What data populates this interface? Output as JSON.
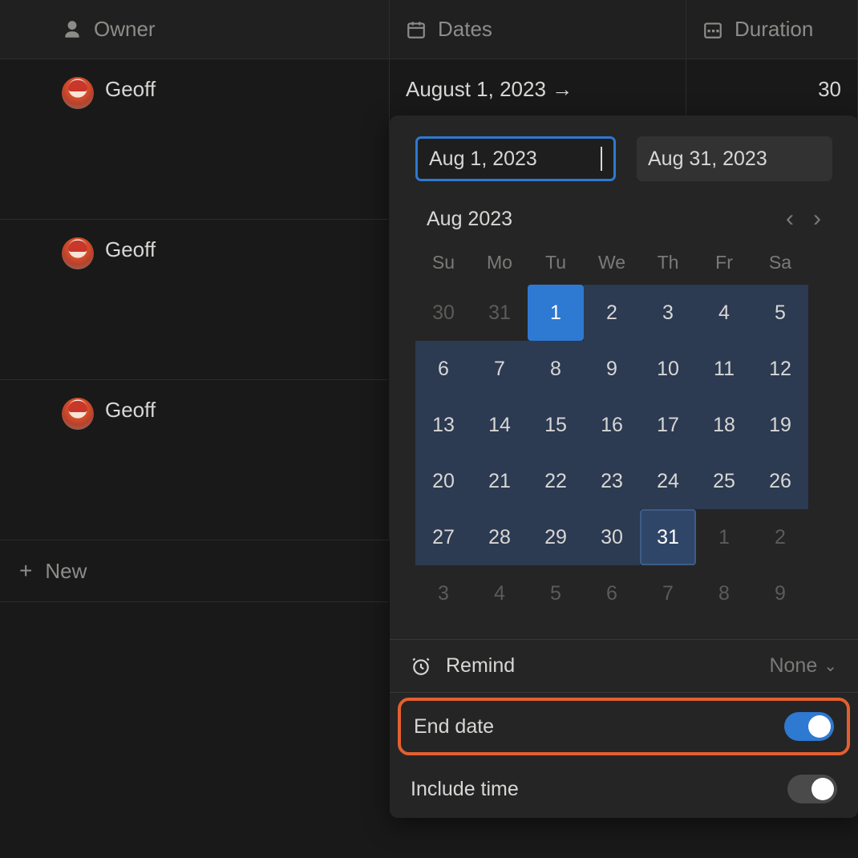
{
  "columns": {
    "owner": "Owner",
    "dates": "Dates",
    "duration": "Duration"
  },
  "rows": [
    {
      "owner": "Geoff",
      "dates": "August 1, 2023 →",
      "duration": "30"
    },
    {
      "owner": "Geoff",
      "dates": "",
      "duration": ""
    },
    {
      "owner": "Geoff",
      "dates": "",
      "duration": ""
    }
  ],
  "newRow": "New",
  "datePicker": {
    "startInput": "Aug 1, 2023",
    "endInput": "Aug 31, 2023",
    "monthTitle": "Aug 2023",
    "dow": [
      "Su",
      "Mo",
      "Tu",
      "We",
      "Th",
      "Fr",
      "Sa"
    ],
    "days": [
      {
        "n": "30",
        "cls": "other"
      },
      {
        "n": "31",
        "cls": "other"
      },
      {
        "n": "1",
        "cls": "selected-start"
      },
      {
        "n": "2",
        "cls": "in-range"
      },
      {
        "n": "3",
        "cls": "in-range"
      },
      {
        "n": "4",
        "cls": "in-range"
      },
      {
        "n": "5",
        "cls": "in-range"
      },
      {
        "n": "6",
        "cls": "in-range"
      },
      {
        "n": "7",
        "cls": "in-range"
      },
      {
        "n": "8",
        "cls": "in-range"
      },
      {
        "n": "9",
        "cls": "in-range"
      },
      {
        "n": "10",
        "cls": "in-range"
      },
      {
        "n": "11",
        "cls": "in-range"
      },
      {
        "n": "12",
        "cls": "in-range"
      },
      {
        "n": "13",
        "cls": "in-range"
      },
      {
        "n": "14",
        "cls": "in-range"
      },
      {
        "n": "15",
        "cls": "in-range"
      },
      {
        "n": "16",
        "cls": "in-range"
      },
      {
        "n": "17",
        "cls": "in-range"
      },
      {
        "n": "18",
        "cls": "in-range"
      },
      {
        "n": "19",
        "cls": "in-range"
      },
      {
        "n": "20",
        "cls": "in-range"
      },
      {
        "n": "21",
        "cls": "in-range"
      },
      {
        "n": "22",
        "cls": "in-range"
      },
      {
        "n": "23",
        "cls": "in-range"
      },
      {
        "n": "24",
        "cls": "in-range"
      },
      {
        "n": "25",
        "cls": "in-range"
      },
      {
        "n": "26",
        "cls": "in-range"
      },
      {
        "n": "27",
        "cls": "in-range"
      },
      {
        "n": "28",
        "cls": "in-range"
      },
      {
        "n": "29",
        "cls": "in-range"
      },
      {
        "n": "30",
        "cls": "in-range"
      },
      {
        "n": "31",
        "cls": "selected-end"
      },
      {
        "n": "1",
        "cls": "other"
      },
      {
        "n": "2",
        "cls": "other"
      },
      {
        "n": "3",
        "cls": "other"
      },
      {
        "n": "4",
        "cls": "other"
      },
      {
        "n": "5",
        "cls": "other"
      },
      {
        "n": "6",
        "cls": "other"
      },
      {
        "n": "7",
        "cls": "other"
      },
      {
        "n": "8",
        "cls": "other"
      },
      {
        "n": "9",
        "cls": "other"
      }
    ],
    "remindLabel": "Remind",
    "remindValue": "None",
    "endDateLabel": "End date",
    "includeTimeLabel": "Include time"
  }
}
